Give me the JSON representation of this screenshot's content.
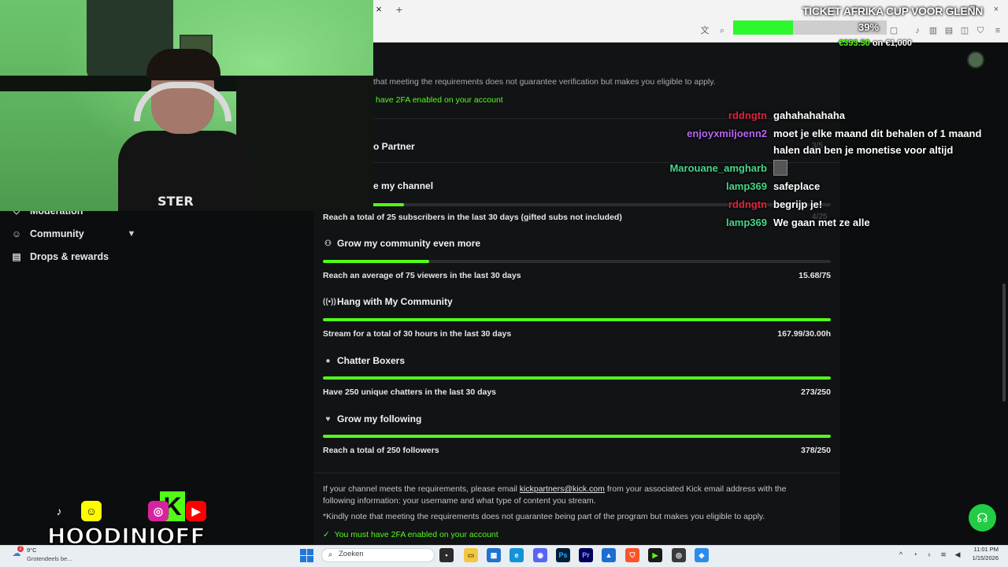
{
  "browser": {
    "tab_close": "×",
    "new_tab": "+",
    "window_controls": [
      "—",
      "❐",
      "×"
    ],
    "address_icons": [
      "translate-icon",
      "zoom-icon",
      "extension-icon",
      "bookmark-icon",
      "sidebar-icon",
      "download-icon",
      "shield-icon",
      "menu-icon"
    ]
  },
  "sidebar": {
    "items": [
      {
        "label": "Moderation",
        "icon": "shield-icon"
      },
      {
        "label": "Community",
        "icon": "people-icon"
      },
      {
        "label": "Drops & rewards",
        "icon": "gift-icon"
      }
    ]
  },
  "partner": {
    "intro_note_tail": "that meeting the requirements does not guarantee verification but makes you eligible to apply.",
    "top_2fa_tail": "have 2FA enabled on your account",
    "section_tail": "o Partner",
    "monetize_tail": "e my channel",
    "subs_req": "Reach a total of 25 subscribers in the last 30 days (gifted subs not included)",
    "requirements": [
      {
        "title": "Grow my community even more",
        "icon": "people-icon",
        "desc": "Reach an average of 75 viewers in the last 30 days",
        "value": "15.68/75",
        "progress": 0.21
      },
      {
        "title": "Hang with My Community",
        "icon": "broadcast-icon",
        "desc": "Stream for a total of 30 hours in the last 30 days",
        "value": "167.99/30.00h",
        "progress": 1.0
      },
      {
        "title": "Chatter Boxers",
        "icon": "chat-icon",
        "desc": "Have 250 unique chatters in the last 30 days",
        "value": "273/250",
        "progress": 1.0
      },
      {
        "title": "Grow my following",
        "icon": "heart-icon",
        "desc": "Reach a total of 250 followers",
        "value": "378/250",
        "progress": 1.0
      }
    ],
    "email_line_1_a": "If your channel meets the requirements, please email ",
    "email_link": "kickpartners@kick.com",
    "email_line_1_b": " from your associated Kick email address with the",
    "email_line_2": "following information: your username and what type of content you stream.",
    "kindly_note": "*Kindly note that meeting the requirements does not guarantee being part of the program but makes you eligible to apply.",
    "bottom_2fa": "You must have 2FA enabled on your account"
  },
  "goal": {
    "title": "TICKET AFRIKA CUP VOOR GLENN",
    "percent_label": "39%",
    "progress": 0.39,
    "current": "€393.50",
    "separator": " on ",
    "target": "€1,000"
  },
  "chat": [
    {
      "user": "rddngtn",
      "msg": "gahahahahaha",
      "color": "#e0243e"
    },
    {
      "user": "enjoyxmiljoenn2",
      "msg": "moet je elke maand dit behalen of 1 maand",
      "msg2": "halen dan ben je monetise voor altijd",
      "color": "#b866f5"
    },
    {
      "user": "Marouane_amgharb",
      "msg": "",
      "color": "#46d88a"
    },
    {
      "user": "lamp369",
      "msg": "safeplace",
      "color": "#46d88a"
    },
    {
      "user": "rddngtn",
      "msg": "begrijp je!",
      "color": "#e0243e"
    },
    {
      "user": "lamp369",
      "msg": "We gaan met ze alle",
      "color": "#46d88a"
    }
  ],
  "chat_ghost": {
    "a": "3/5",
    "b": "4/25"
  },
  "webcam": {
    "shirt_text": "STER"
  },
  "social": {
    "brand": "HOODINIOFF",
    "k_letter": "K",
    "icons": [
      "tiktok-icon",
      "snapchat-icon",
      "kick-icon",
      "instagram-icon",
      "youtube-icon"
    ]
  },
  "taskbar": {
    "weather_temp": "9°C",
    "weather_text": "Grotendeels be...",
    "notif_count": "2",
    "search_placeholder": "Zoeken",
    "time": "11:01 PM",
    "date": "1/15/2026"
  },
  "colors": {
    "accent": "#53fc18",
    "panel_bg": "#111315",
    "page_bg": "#0b0d0e"
  }
}
